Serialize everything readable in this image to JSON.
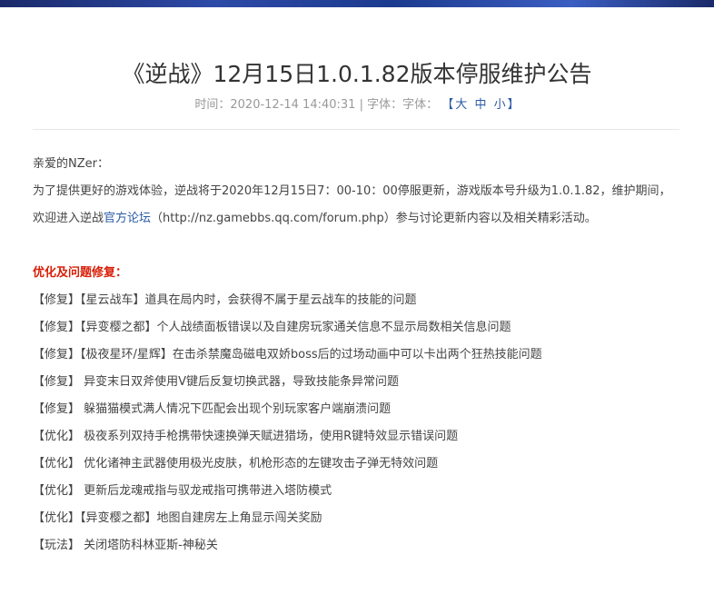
{
  "header": {
    "title": "《逆战》12月15日1.0.1.82版本停服维护公告",
    "time_label": "时间：",
    "time_value": "2020-12-14 14:40:31",
    "separator": " | ",
    "font_label": "字体：字体：",
    "bracket_open": "【",
    "bracket_close": "】",
    "font_sizes": [
      "大",
      "中",
      "小"
    ]
  },
  "body": {
    "greeting": "亲爱的NZer：",
    "intro_part1": "为了提供更好的游戏体验，逆战将于2020年12月15日7：00-10：00停服更新，游戏版本号升级为1.0.1.82，维护期间，欢迎进入逆战",
    "forum_link_text": "官方论坛",
    "forum_url": "（http://nz.gamebbs.qq.com/forum.php）",
    "intro_part2": "参与讨论更新内容以及相关精彩活动。",
    "section_title": "优化及问题修复：",
    "items": [
      "【修复】【星云战车】道具在局内时，会获得不属于星云战车的技能的问题",
      "【修复】【异变樱之都】个人战绩面板错误以及自建房玩家通关信息不显示局数相关信息问题",
      "【修复】【极夜星环/星辉】在击杀禁魔岛磁电双娇boss后的过场动画中可以卡出两个狂热技能问题",
      "【修复】 异变末日双斧使用V键后反复切换武器，导致技能条异常问题",
      "【修复】 躲猫猫模式满人情况下匹配会出现个别玩家客户端崩溃问题",
      "【优化】 极夜系列双持手枪携带快速换弹天赋进猎场，使用R键特效显示错误问题",
      "【优化】 优化诸神主武器使用极光皮肤，机枪形态的左键攻击子弹无特效问题",
      "【优化】 更新后龙魂戒指与驭龙戒指可携带进入塔防模式",
      "【优化】【异变樱之都】地图自建房左上角显示闯关奖励",
      "【玩法】 关闭塔防科林亚斯-神秘关"
    ]
  }
}
